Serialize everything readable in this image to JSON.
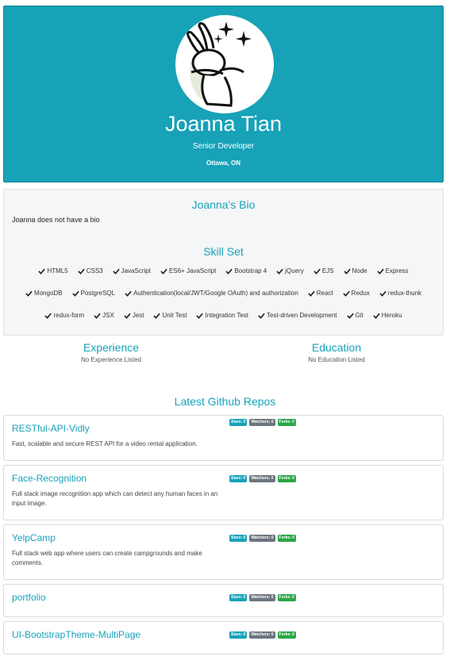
{
  "profile": {
    "name": "Joanna Tian",
    "role": "Senior Developer",
    "location": "Ottawa, ON"
  },
  "bio": {
    "title": "Joanna's Bio",
    "text": "Joanna does not have a bio"
  },
  "skills": {
    "title": "Skill Set",
    "rows": [
      [
        "HTML5",
        "CSS3",
        "JavaScript",
        "ES6+ JavaScript",
        "Bootstrap 4",
        "jQuery",
        "EJS",
        "Node",
        "Express"
      ],
      [
        "MongoDB",
        "PostgreSQL",
        "Authentication(local/JWT/Google OAuth) and authorization",
        "React",
        "Redux",
        "redux-thunk"
      ],
      [
        "redux-form",
        "JSX",
        "Jest",
        "Unit Test",
        "Integration Test",
        "Test-driven Development",
        "Git",
        "Heroku"
      ]
    ]
  },
  "experience": {
    "title": "Experience",
    "empty": "No Experience Listed"
  },
  "education": {
    "title": "Education",
    "empty": "No Education Listed"
  },
  "repos": {
    "title": "Latest Github Repos",
    "items": [
      {
        "name": "RESTful-API-Vidly",
        "description": "Fast, scalable and secure REST API for a video rental application.",
        "stars": "Stars: 0",
        "watchers": "Watchers: 0",
        "forks": "Forks: 0"
      },
      {
        "name": "Face-Recognition",
        "description": "Full stack image recognition app which can detect any human faces in an input image.",
        "stars": "Stars: 0",
        "watchers": "Watchers: 0",
        "forks": "Forks: 0"
      },
      {
        "name": "YelpCamp",
        "description": "Full stack web app where users can create campgrounds and make comments.",
        "stars": "Stars: 0",
        "watchers": "Watchers: 0",
        "forks": "Forks: 0"
      },
      {
        "name": "portfolio",
        "description": "",
        "stars": "Stars: 0",
        "watchers": "Watchers: 0",
        "forks": "Forks: 0"
      },
      {
        "name": "UI-BootstrapTheme-MultiPage",
        "description": "",
        "stars": "Stars: 0",
        "watchers": "Watchers: 0",
        "forks": "Forks: 0"
      }
    ]
  },
  "colors": {
    "accent": "#17a2b8",
    "stars": "#17a2b8",
    "watchers": "#6c757d",
    "forks": "#28a745"
  },
  "icons": {
    "skill": "check-icon",
    "avatar": "bunny-avatar"
  }
}
